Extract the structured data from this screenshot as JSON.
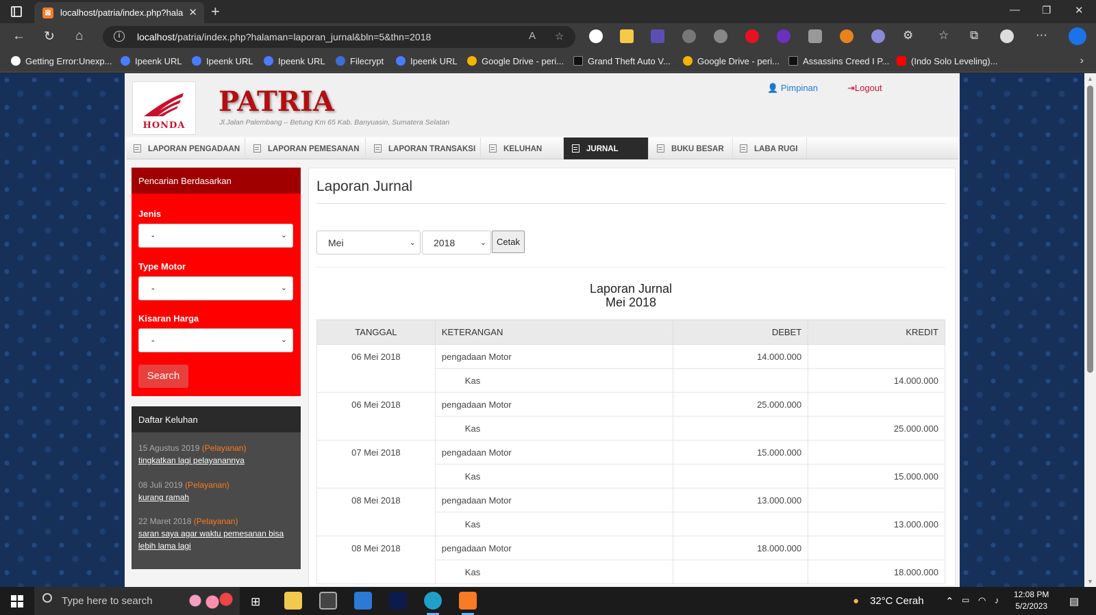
{
  "browser": {
    "tab_title": "localhost/patria/index.php?halaman",
    "tab_favicon": "xampp-icon",
    "url_host": "localhost",
    "url_path": "/patria/index.php?halaman=laporan_jurnal&bln=5&thn=2018",
    "bookmarks": [
      {
        "label": "Getting Error:Unexp...",
        "icon": "github-icon",
        "color": "#ffffff"
      },
      {
        "label": "Ipeenk URL",
        "icon": "shield-icon",
        "color": "#4a7cff"
      },
      {
        "label": "Ipeenk URL",
        "icon": "shield-icon",
        "color": "#4a7cff"
      },
      {
        "label": "Ipeenk URL",
        "icon": "shield-icon",
        "color": "#4a7cff"
      },
      {
        "label": "Filecrypt",
        "icon": "shield-icon",
        "color": "#3b6fd6"
      },
      {
        "label": "Ipeenk URL",
        "icon": "shield-icon",
        "color": "#4a7cff"
      },
      {
        "label": "Google Drive - peri...",
        "icon": "drive-icon",
        "color": "#f4b400"
      },
      {
        "label": "Grand Theft Auto V...",
        "icon": "di-icon",
        "color": "#222222"
      },
      {
        "label": "Google Drive - peri...",
        "icon": "drive-icon",
        "color": "#f4b400"
      },
      {
        "label": "Assassins Creed I P...",
        "icon": "di-icon",
        "color": "#222222"
      },
      {
        "label": "(Indo Solo Leveling)...",
        "icon": "youtube-icon",
        "color": "#ff0000"
      }
    ]
  },
  "header": {
    "brand": "PATRIA",
    "logo_text": "HONDA",
    "address": "Jl.Jalan Palembang – Betung Km 65 Kab. Banyuasin, Sumatera Selatan",
    "user_link": "Pimpinan",
    "logout_link": "Logout"
  },
  "nav": [
    {
      "label": "LAPORAN PENGADAAN",
      "active": false
    },
    {
      "label": "LAPORAN PEMESANAN",
      "active": false
    },
    {
      "label": "LAPORAN TRANSAKSI",
      "active": false
    },
    {
      "label": "KELUHAN",
      "active": false
    },
    {
      "label": "JURNAL",
      "active": true
    },
    {
      "label": "BUKU BESAR",
      "active": false
    },
    {
      "label": "LABA RUGI",
      "active": false
    }
  ],
  "search_panel": {
    "title": "Pencarian Berdasarkan",
    "jenis_label": "Jenis",
    "jenis_value": "-",
    "type_label": "Type Motor",
    "type_value": "-",
    "harga_label": "Kisaran Harga",
    "harga_value": "-",
    "button": "Search"
  },
  "complaints": {
    "title": "Daftar Keluhan",
    "items": [
      {
        "date": "15 Agustus 2019",
        "category": "(Pelayanan)",
        "text": "tingkatkan lagi pelayanannya"
      },
      {
        "date": "08 Juli 2019",
        "category": "(Pelayanan)",
        "text": "kurang ramah"
      },
      {
        "date": "22 Maret 2018",
        "category": "(Pelayanan)",
        "text": "saran saya agar waktu pemesanan bisa lebih lama lagi"
      }
    ]
  },
  "content": {
    "title": "Laporan Jurnal",
    "month_value": "Mei",
    "year_value": "2018",
    "print_button": "Cetak",
    "report_title": "Laporan Jurnal",
    "report_period": "Mei 2018",
    "columns": [
      "TANGGAL",
      "KETERANGAN",
      "DEBET",
      "KREDIT"
    ],
    "entries": [
      {
        "date": "06 Mei 2018",
        "debit_desc": "pengadaan Motor",
        "debit": "14.000.000",
        "credit_desc": "Kas",
        "credit": "14.000.000"
      },
      {
        "date": "06 Mei 2018",
        "debit_desc": "pengadaan Motor",
        "debit": "25.000.000",
        "credit_desc": "Kas",
        "credit": "25.000.000"
      },
      {
        "date": "07 Mei 2018",
        "debit_desc": "pengadaan Motor",
        "debit": "15.000.000",
        "credit_desc": "Kas",
        "credit": "15.000.000"
      },
      {
        "date": "08 Mei 2018",
        "debit_desc": "pengadaan Motor",
        "debit": "13.000.000",
        "credit_desc": "Kas",
        "credit": "13.000.000"
      },
      {
        "date": "08 Mei 2018",
        "debit_desc": "pengadaan Motor",
        "debit": "18.000.000",
        "credit_desc": "Kas",
        "credit": "18.000.000"
      }
    ]
  },
  "taskbar": {
    "search_placeholder": "Type here to search",
    "weather": "32°C  Cerah",
    "time": "12:08 PM",
    "date": "5/2/2023"
  }
}
